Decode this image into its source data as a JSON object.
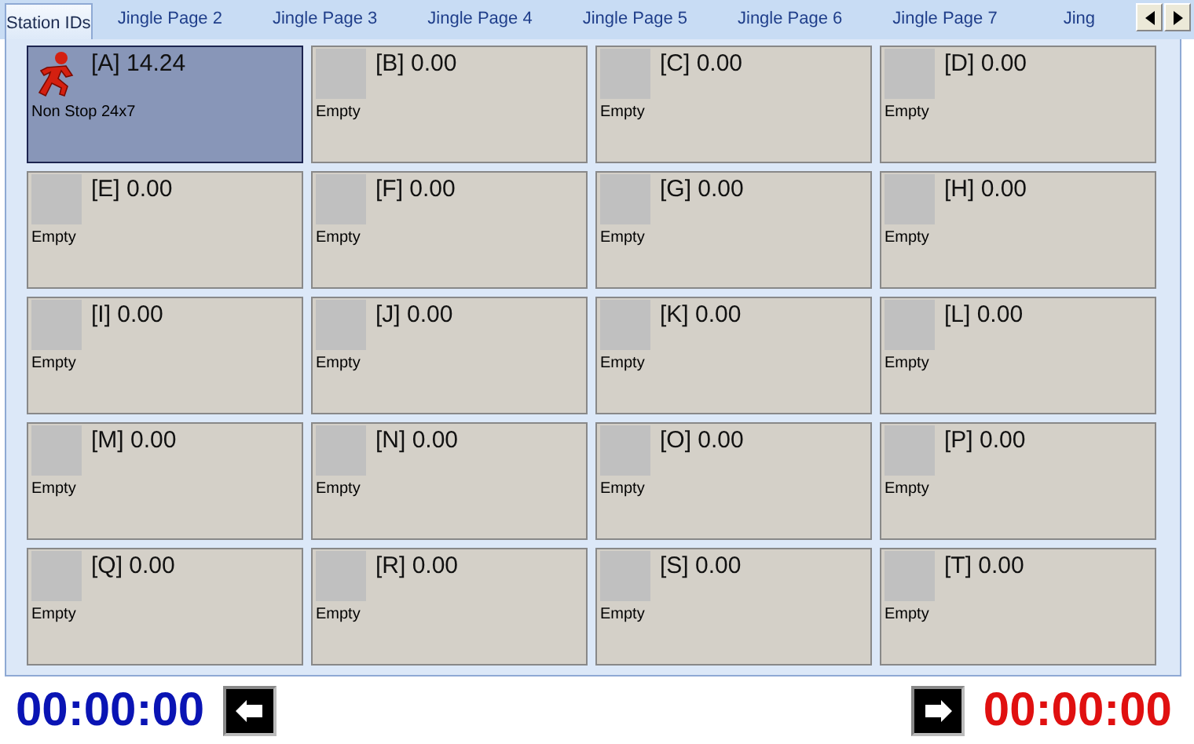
{
  "tabs": [
    {
      "label": "Station IDs",
      "selected": true
    },
    {
      "label": "Jingle Page 2",
      "selected": false
    },
    {
      "label": "Jingle Page 3",
      "selected": false
    },
    {
      "label": "Jingle Page 4",
      "selected": false
    },
    {
      "label": "Jingle Page 5",
      "selected": false
    },
    {
      "label": "Jingle Page 6",
      "selected": false
    },
    {
      "label": "Jingle Page 7",
      "selected": false
    },
    {
      "label": "Jing",
      "selected": false
    }
  ],
  "cells": [
    {
      "title": "[A] 14.24",
      "caption": "Non Stop 24x7",
      "kind": "jingle",
      "selected": true
    },
    {
      "title": "[B] 0.00",
      "caption": "Empty",
      "kind": "empty",
      "selected": false
    },
    {
      "title": "[C] 0.00",
      "caption": "Empty",
      "kind": "empty",
      "selected": false
    },
    {
      "title": "[D] 0.00",
      "caption": "Empty",
      "kind": "empty",
      "selected": false
    },
    {
      "title": "[E] 0.00",
      "caption": "Empty",
      "kind": "empty",
      "selected": false
    },
    {
      "title": "[F] 0.00",
      "caption": "Empty",
      "kind": "empty",
      "selected": false
    },
    {
      "title": "[G] 0.00",
      "caption": "Empty",
      "kind": "empty",
      "selected": false
    },
    {
      "title": "[H] 0.00",
      "caption": "Empty",
      "kind": "empty",
      "selected": false
    },
    {
      "title": "[I] 0.00",
      "caption": "Empty",
      "kind": "empty",
      "selected": false
    },
    {
      "title": "[J] 0.00",
      "caption": "Empty",
      "kind": "empty",
      "selected": false
    },
    {
      "title": "[K] 0.00",
      "caption": "Empty",
      "kind": "empty",
      "selected": false
    },
    {
      "title": "[L] 0.00",
      "caption": "Empty",
      "kind": "empty",
      "selected": false
    },
    {
      "title": "[M] 0.00",
      "caption": "Empty",
      "kind": "empty",
      "selected": false
    },
    {
      "title": "[N] 0.00",
      "caption": "Empty",
      "kind": "empty",
      "selected": false
    },
    {
      "title": "[O] 0.00",
      "caption": "Empty",
      "kind": "empty",
      "selected": false
    },
    {
      "title": "[P] 0.00",
      "caption": "Empty",
      "kind": "empty",
      "selected": false
    },
    {
      "title": "[Q] 0.00",
      "caption": "Empty",
      "kind": "empty",
      "selected": false
    },
    {
      "title": "[R] 0.00",
      "caption": "Empty",
      "kind": "empty",
      "selected": false
    },
    {
      "title": "[S] 0.00",
      "caption": "Empty",
      "kind": "empty",
      "selected": false
    },
    {
      "title": "[T] 0.00",
      "caption": "Empty",
      "kind": "empty",
      "selected": false
    }
  ],
  "elapsed": "00:00:00",
  "remaining": "00:00:00"
}
